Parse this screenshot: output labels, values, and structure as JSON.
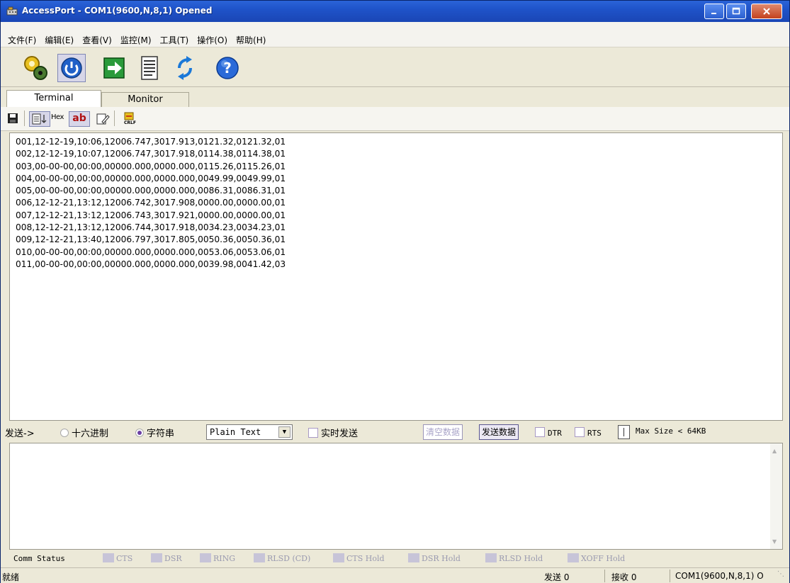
{
  "window": {
    "title": "AccessPort - COM1(9600,N,8,1) Opened"
  },
  "menu": [
    "文件(F)",
    "编辑(E)",
    "查看(V)",
    "监控(M)",
    "工具(T)",
    "操作(O)",
    "帮助(H)"
  ],
  "toolbar": {
    "icons": [
      "settings-gears-icon",
      "power-icon",
      "arrow-right-icon",
      "document-icon",
      "refresh-icon",
      "help-icon"
    ]
  },
  "tabs": {
    "terminal": "Terminal",
    "monitor": "Monitor"
  },
  "subtoolbar": {
    "hex_label": "Hex",
    "ab_label": "ab",
    "crlf_label": "CRLF"
  },
  "terminal_lines": [
    "001,12-12-19,10:06,12006.747,3017.913,0121.32,0121.32,01",
    "002,12-12-19,10:07,12006.747,3017.918,0114.38,0114.38,01",
    "003,00-00-00,00:00,00000.000,0000.000,0115.26,0115.26,01",
    "004,00-00-00,00:00,00000.000,0000.000,0049.99,0049.99,01",
    "005,00-00-00,00:00,00000.000,0000.000,0086.31,0086.31,01",
    "006,12-12-21,13:12,12006.742,3017.908,0000.00,0000.00,01",
    "007,12-12-21,13:12,12006.743,3017.921,0000.00,0000.00,01",
    "008,12-12-21,13:12,12006.744,3017.918,0034.23,0034.23,01",
    "009,12-12-21,13:40,12006.797,3017.805,0050.36,0050.36,01",
    "010,00-00-00,00:00,00000.000,0000.000,0053.06,0053.06,01",
    "011,00-00-00,00:00,00000.000,0000.000,0039.98,0041.42,03"
  ],
  "sendbar": {
    "send_label": "发送->",
    "hex_radio": "十六进制",
    "string_radio": "字符串",
    "format": "Plain Text",
    "realtime": "实时发送",
    "clear": "清空数据",
    "send": "发送数据",
    "dtr": "DTR",
    "rts": "RTS",
    "maxsize": "Max Size < 64KB"
  },
  "comm_status": {
    "label": "Comm Status",
    "items": [
      "CTS",
      "DSR",
      "RING",
      "RLSD (CD)",
      "CTS Hold",
      "DSR Hold",
      "RLSD Hold",
      "XOFF Hold"
    ]
  },
  "statusbar": {
    "ready": "就绪",
    "sent": "发送 0",
    "received": "接收 0",
    "port": "COM1(9600,N,8,1) O"
  }
}
